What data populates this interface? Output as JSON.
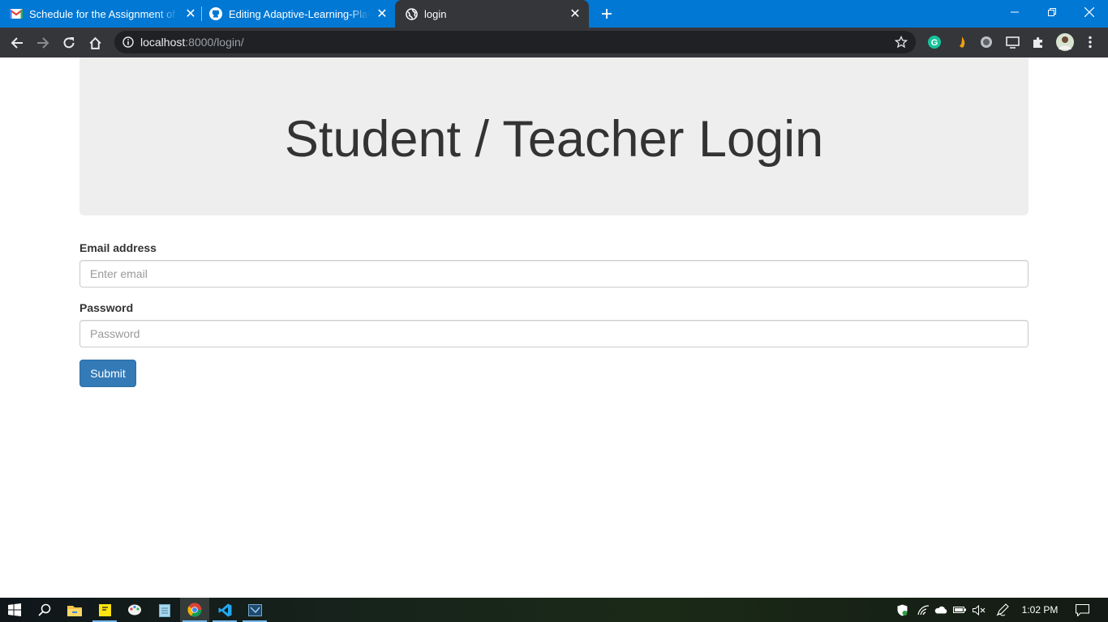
{
  "browser": {
    "tabs": [
      {
        "title": "Schedule for the Assignment of C",
        "favicon": "gmail-icon"
      },
      {
        "title": "Editing Adaptive-Learning-Platfo",
        "favicon": "github-icon"
      },
      {
        "title": "login",
        "favicon": "globe-icon"
      }
    ],
    "active_tab_index": 2,
    "url_host": "localhost",
    "url_rest": ":8000/login/"
  },
  "page": {
    "heading": "Student / Teacher Login",
    "email_label": "Email address",
    "email_placeholder": "Enter email",
    "email_value": "",
    "password_label": "Password",
    "password_placeholder": "Password",
    "password_value": "",
    "submit_label": "Submit"
  },
  "taskbar": {
    "clock": "1:02 PM",
    "pinned": [
      "windows-start-icon",
      "search-icon",
      "file-explorer-icon",
      "sticky-notes-icon",
      "paint-icon",
      "notepad-icon",
      "chrome-icon",
      "vscode-icon",
      "sql-icon"
    ]
  },
  "colors": {
    "tabstrip": "#0078d4",
    "toolbar": "#35363a",
    "jumbotron": "#eeeeee",
    "primary_button": "#337ab7"
  }
}
